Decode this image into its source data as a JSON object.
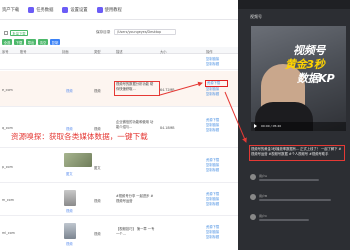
{
  "nav": {
    "items": [
      "资产下载",
      "任务数据",
      "设置设置",
      "使用教程"
    ]
  },
  "toolbar": {
    "batch_download": "批量下载",
    "btn_green_1": "全选",
    "btn_green_2": "下载",
    "btn_green_3": "导出",
    "btn_green_4": "清空",
    "btn_blue": "复制",
    "path_label": "保存目录",
    "path_value": "/Users/youngeyes/Desktop"
  },
  "table": {
    "headers": [
      "序号",
      "账号",
      "封面",
      "类型",
      "描述",
      "大小",
      "操作"
    ],
    "rows": [
      {
        "num": "",
        "account": "",
        "tag": "",
        "type": "",
        "desc": "",
        "size": "",
        "ops": [
          "复制链接",
          "复制标题"
        ]
      },
      {
        "num": "",
        "account": "e_com",
        "tag": "视频",
        "type": "视频",
        "desc": "视频号的数据分析功能 助你快速获取...",
        "size": "64.72MB",
        "ops": [
          "资源下载",
          "复制链接",
          "复制标题"
        ]
      },
      {
        "num": "",
        "account": "q_com",
        "tag": "视频",
        "type": "视频",
        "desc": "企业微信的功能和使用 功能介绍与...",
        "size": "84.18MB",
        "ops": [
          "资源下载",
          "复制链接",
          "复制标题"
        ]
      },
      {
        "num": "",
        "account": "p_com",
        "tag": "图文",
        "type": "图文",
        "desc": "",
        "size": "",
        "ops": [
          "资源下载",
          "复制链接",
          "复制标题"
        ]
      },
      {
        "num": "",
        "account": "m_com",
        "tag": "视频",
        "type": "视频",
        "desc": "#视频号分享 一起进步 #视频号运营",
        "size": "",
        "ops": [
          "资源下载",
          "复制链接",
          "复制标题"
        ]
      },
      {
        "num": "",
        "account": "ml_com",
        "tag": "视频",
        "type": "视频",
        "desc": "【视频技巧】 第一章 一专一个...",
        "size": "",
        "ops": [
          "资源下载",
          "复制链接",
          "复制标题"
        ]
      }
    ]
  },
  "annotation": "资源嗅探：获取各类媒体数据，一键下载",
  "phone": {
    "title": "视频号",
    "video_line1": "视频号",
    "video_line2": "黄金3秒",
    "video_line3": "数据KP",
    "time": "00:00 / 05:20",
    "caption": "视频号的黄金3秒播放率数据有... 正式上线了！ 一起了解下 #视频号运营 #视频号数据 #个人视频号 #视频号助手",
    "comment_names": [
      "用户A",
      "用户B",
      "用户C"
    ]
  },
  "colors": {
    "accent": "#6b5cf6",
    "green": "#4cb86a",
    "blue": "#3b82f6",
    "annotation": "#e53935"
  }
}
